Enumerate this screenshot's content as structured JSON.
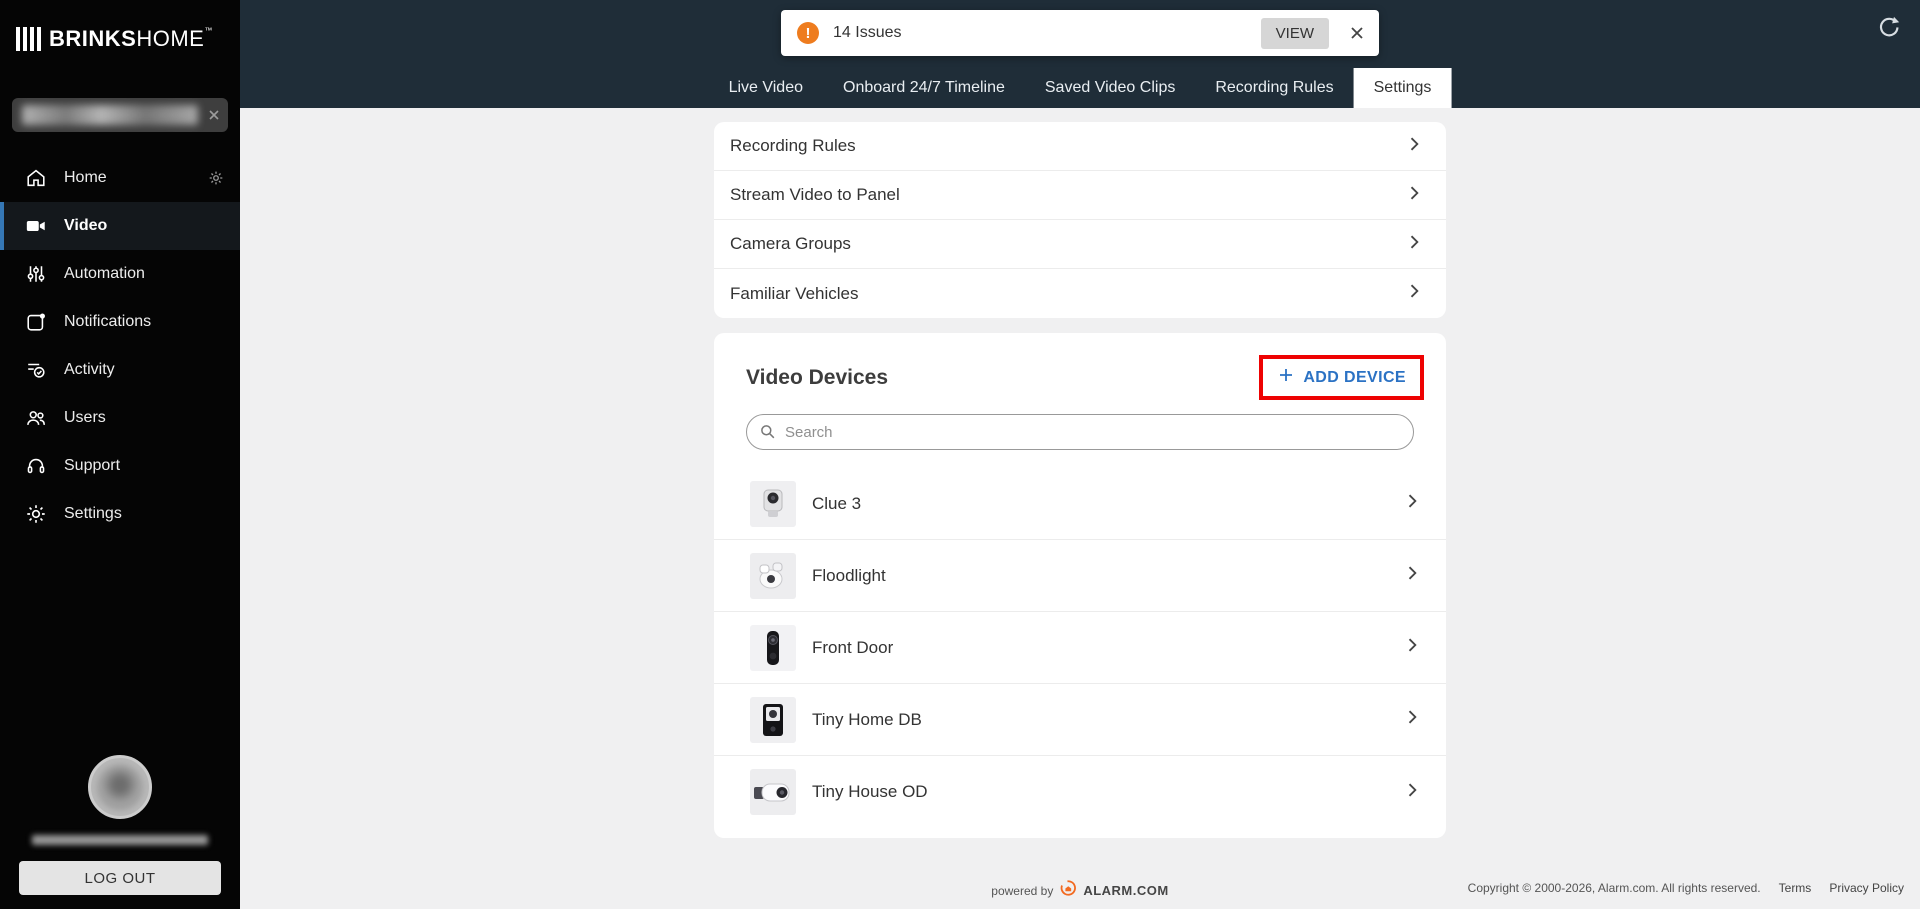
{
  "brand": {
    "bold": "BRINKS",
    "light": "HOME",
    "tm": "™"
  },
  "sidebar": {
    "nav": [
      {
        "label": "Home"
      },
      {
        "label": "Video"
      },
      {
        "label": "Automation"
      },
      {
        "label": "Notifications"
      },
      {
        "label": "Activity"
      },
      {
        "label": "Users"
      },
      {
        "label": "Support"
      },
      {
        "label": "Settings"
      }
    ],
    "logout": "LOG OUT"
  },
  "header": {
    "toast": {
      "message": "14 Issues",
      "view": "VIEW"
    },
    "tabs": [
      "Live Video",
      "Onboard 24/7 Timeline",
      "Saved Video Clips",
      "Recording Rules",
      "Settings"
    ]
  },
  "settings_card": {
    "rows": [
      "Recording Rules",
      "Stream Video to Panel",
      "Camera Groups",
      "Familiar Vehicles"
    ]
  },
  "devices_card": {
    "title": "Video Devices",
    "add_device": "ADD DEVICE",
    "search_placeholder": "Search",
    "rows": [
      "Clue 3",
      "Floodlight",
      "Front Door",
      "Tiny Home DB",
      "Tiny House OD"
    ]
  },
  "footer": {
    "powered_by": "powered by",
    "alarm_brand": "ALARM.COM",
    "copyright": "Copyright © 2000-2026, Alarm.com. All rights reserved.",
    "terms": "Terms",
    "privacy": "Privacy Policy"
  },
  "icons": {
    "warning_glyph": "!"
  },
  "colors": {
    "header_bg": "#1f2d38",
    "accent_blue": "#2b72c4",
    "annotation_red": "#ee0202",
    "toast_orange": "#ee7c1e"
  }
}
